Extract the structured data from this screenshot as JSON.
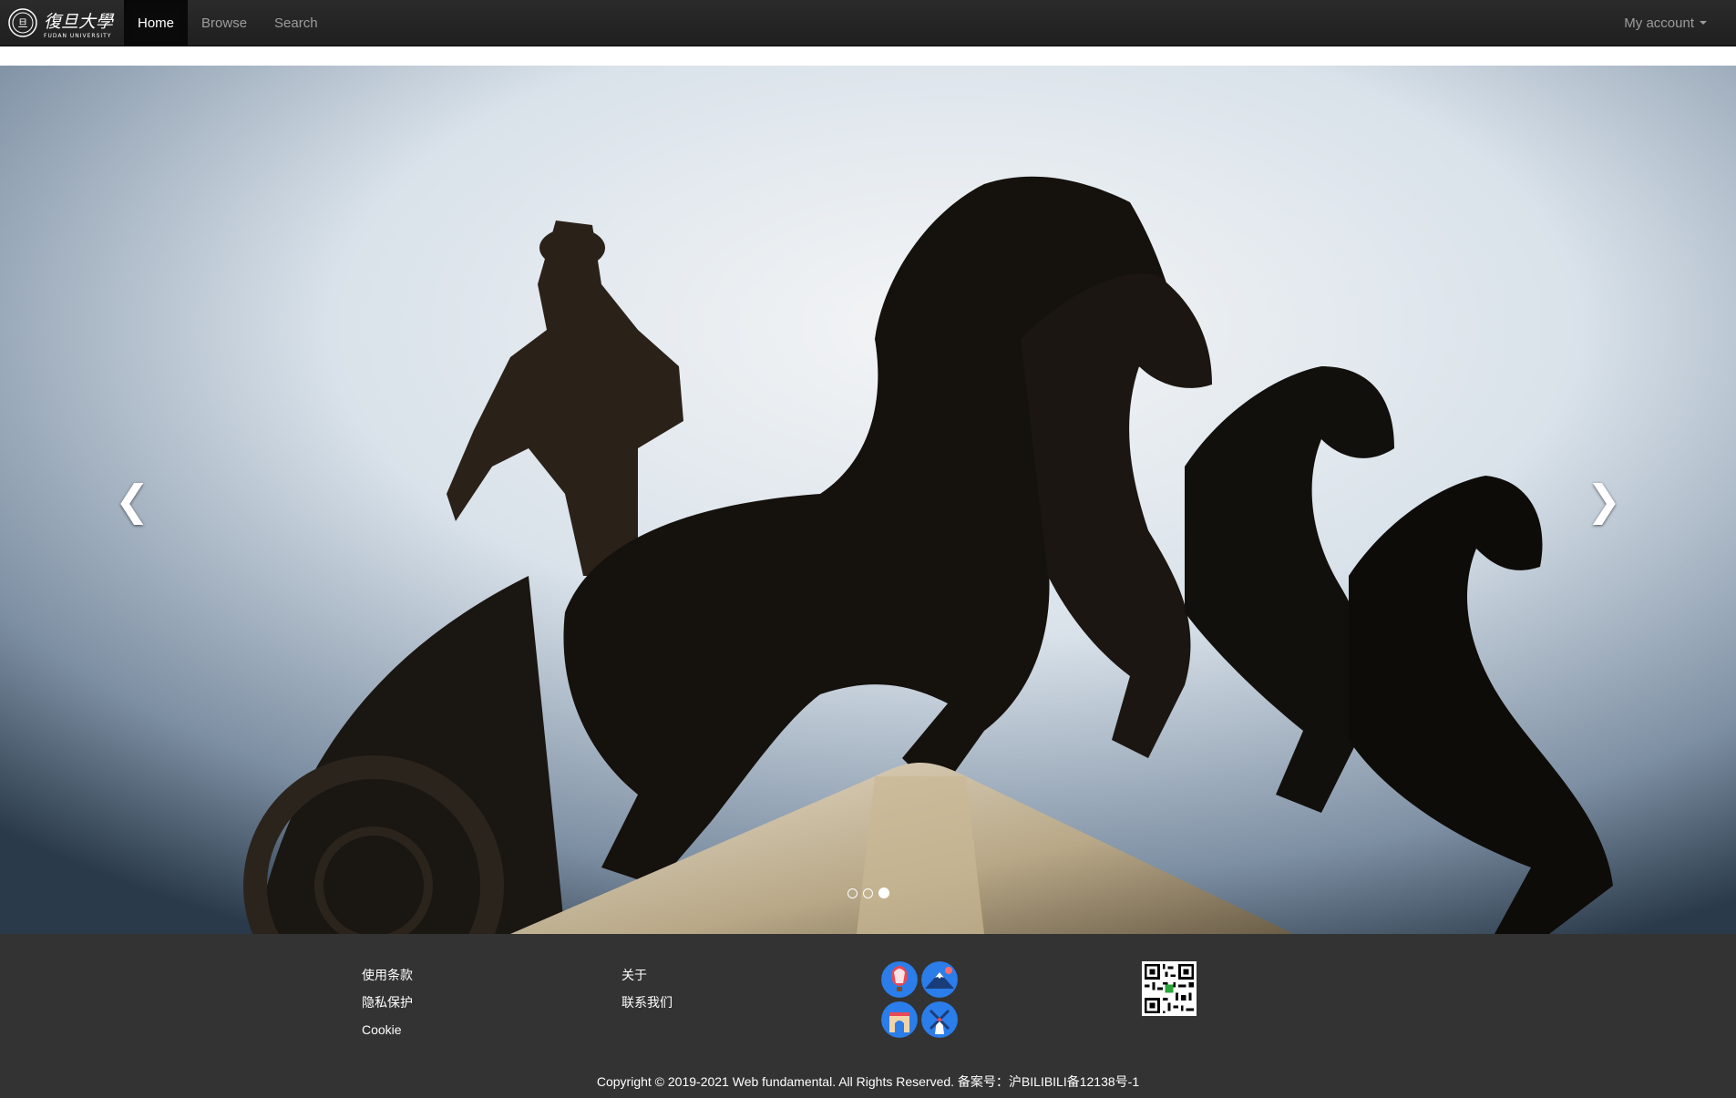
{
  "navbar": {
    "brand": {
      "logo_lines": [
        "復旦大學",
        "FUDAN UNIVERSITY"
      ]
    },
    "links": [
      {
        "label": "Home",
        "active": true
      },
      {
        "label": "Browse",
        "active": false
      },
      {
        "label": "Search",
        "active": false
      }
    ],
    "account_label": "My account"
  },
  "carousel": {
    "prev_icon": "chevron-left-icon",
    "next_icon": "chevron-right-icon",
    "prev_glyph": "❮",
    "next_glyph": "❯",
    "slide_count": 3,
    "active_index": 2
  },
  "footer": {
    "col1": [
      "使用条款",
      "隐私保护",
      "Cookie"
    ],
    "col2": [
      "关于",
      "联系我们"
    ],
    "icons": [
      "hot-air-balloon-icon",
      "mount-fuji-icon",
      "arc-de-triomphe-icon",
      "windmill-icon"
    ],
    "copyright": "Copyright © 2019-2021 Web fundamental. All Rights Reserved. 备案号：沪BILIBILI备12138号-1"
  },
  "colors": {
    "navbar": "#222222",
    "footer": "#333333",
    "icon_blue": "#2b7de9"
  }
}
